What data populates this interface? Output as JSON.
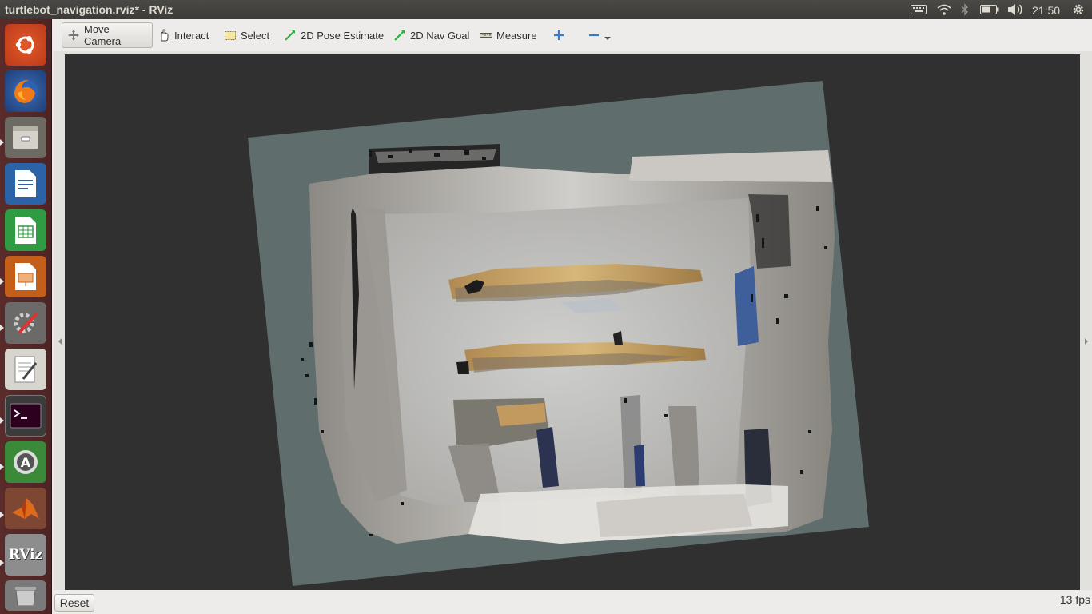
{
  "window": {
    "title": "turtlebot_navigation.rviz* - RViz"
  },
  "top_panel": {
    "clock": "21:50",
    "tray_icons": [
      "keyboard-icon",
      "wifi-icon",
      "bluetooth-icon",
      "battery-icon",
      "volume-icon",
      "gear-icon"
    ]
  },
  "launcher": {
    "items": [
      "ubuntu-dash",
      "firefox",
      "files",
      "writer",
      "calc",
      "impress",
      "system-settings",
      "text-editor",
      "terminal",
      "software-updater",
      "matlab",
      "rviz",
      "trash"
    ],
    "rviz_label": "RViz"
  },
  "toolbar": {
    "move_camera": "Move Camera",
    "interact": "Interact",
    "select": "Select",
    "pose_estimate": "2D Pose Estimate",
    "nav_goal": "2D Nav Goal",
    "measure": "Measure"
  },
  "status": {
    "reset_label": "Reset",
    "fps": "13 fps"
  },
  "colors": {
    "launcher_bg": "#5a2b2b",
    "viewport_bg": "#303030",
    "map_plane": "#5f6d6c",
    "tool_accent": "#2db84a"
  }
}
